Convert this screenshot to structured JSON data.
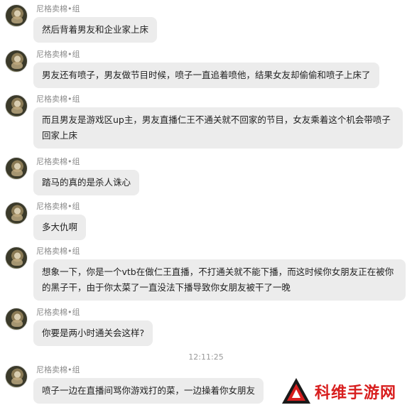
{
  "messages": [
    {
      "sender": "尼格卖棉•组",
      "text": "然后背着男友和企业家上床"
    },
    {
      "sender": "尼格卖棉•组",
      "text": "男友还有喷子，男友做节目时候，喷子一直追着喷他，结果女友却偷偷和喷子上床了"
    },
    {
      "sender": "尼格卖棉•组",
      "text": "而且男友是游戏区up主，男友直播仁王不通关就不回家的节目，女友乘着这个机会带喷子回家上床"
    },
    {
      "sender": "尼格卖棉•组",
      "text": "踏马的真的是杀人诛心"
    },
    {
      "sender": "尼格卖棉•组",
      "text": "多大仇啊"
    },
    {
      "sender": "尼格卖棉•组",
      "text": "想象一下，你是一个vtb在做仁王直播，不打通关就不能下播，而这时候你女朋友正在被你的黑子干，由于你太菜了一直没法下播导致你女朋友被干了一晚"
    },
    {
      "sender": "尼格卖棉•组",
      "text": "你要是两小时通关会这样?"
    },
    {
      "sender": "尼格卖棉•组",
      "text": "喷子一边在直播间骂你游戏打的菜，一边操着你女朋友"
    }
  ],
  "timestamp": "12:11:25",
  "watermark": {
    "text": "科维手游网",
    "color": "#d81e1e"
  }
}
